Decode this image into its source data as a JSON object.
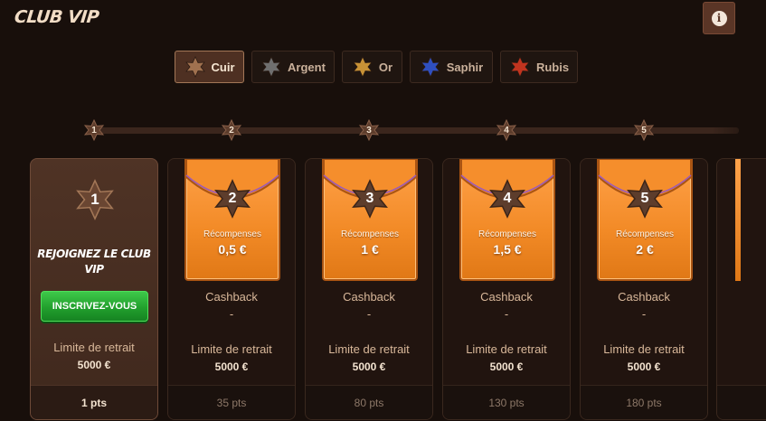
{
  "header": {
    "title": "CLUB VIP",
    "info_icon": "info-icon"
  },
  "tabs": [
    {
      "label": "Cuir",
      "color": "#a0714f",
      "active": true
    },
    {
      "label": "Argent",
      "color": "#6f6f6f",
      "active": false
    },
    {
      "label": "Or",
      "color": "#c89236",
      "active": false
    },
    {
      "label": "Saphir",
      "color": "#2f4fbf",
      "active": false
    },
    {
      "label": "Rubis",
      "color": "#c0341f",
      "active": false
    }
  ],
  "progress_markers": [
    "1",
    "2",
    "3",
    "4",
    "5"
  ],
  "join_card": {
    "level": "1",
    "title": "REJOIGNEZ LE CLUB VIP",
    "button": "INSCRIVEZ-VOUS",
    "limit_label": "Limite de retrait",
    "limit_value": "5000 €",
    "points": "1 pts"
  },
  "levels": [
    {
      "level": "2",
      "rewards_label": "Récompenses",
      "reward": "0,5 €",
      "cashback_label": "Cashback",
      "cashback": "-",
      "limit_label": "Limite de retrait",
      "limit_value": "5000 €",
      "points": "35 pts"
    },
    {
      "level": "3",
      "rewards_label": "Récompenses",
      "reward": "1 €",
      "cashback_label": "Cashback",
      "cashback": "-",
      "limit_label": "Limite de retrait",
      "limit_value": "5000 €",
      "points": "80 pts"
    },
    {
      "level": "4",
      "rewards_label": "Récompenses",
      "reward": "1,5 €",
      "cashback_label": "Cashback",
      "cashback": "-",
      "limit_label": "Limite de retrait",
      "limit_value": "5000 €",
      "points": "130 pts"
    },
    {
      "level": "5",
      "rewards_label": "Récompenses",
      "reward": "2 €",
      "cashback_label": "Cashback",
      "cashback": "-",
      "limit_label": "Limite de retrait",
      "limit_value": "5000 €",
      "points": "180 pts"
    }
  ],
  "colors": {
    "background": "#180f0b",
    "leather_star": "#5d3d2c",
    "envelope": "#f28a26",
    "join_button": "#22a02d"
  }
}
